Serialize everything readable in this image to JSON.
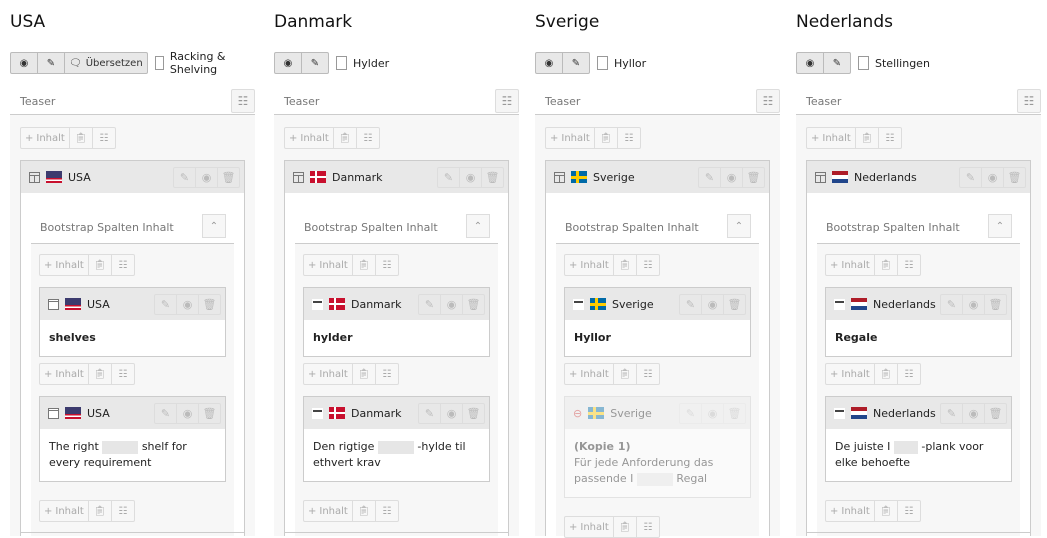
{
  "columns": [
    {
      "language": "USA",
      "flag": "flag-us",
      "toolbar": {
        "view_icon": "eye-icon",
        "edit_icon": "pencil-icon",
        "translate_label": "Übersetzen"
      },
      "page_title": "Racking & Shelving",
      "teaser_label": "Teaser",
      "container": {
        "label": "USA",
        "section_title": "Bootstrap Spalten Inhalt"
      },
      "elements": [
        {
          "label": "USA",
          "text": "shelves",
          "bold": true,
          "hidden": false
        },
        {
          "label": "USA",
          "text_before": "The right",
          "text_after": "shelf for every requirement",
          "bold": false,
          "hidden": false
        }
      ]
    },
    {
      "language": "Danmark",
      "flag": "flag-dk",
      "toolbar": {
        "view_icon": "eye-icon",
        "edit_icon": "pencil-icon"
      },
      "page_title": "Hylder",
      "teaser_label": "Teaser",
      "container": {
        "label": "Danmark",
        "section_title": "Bootstrap Spalten Inhalt"
      },
      "elements": [
        {
          "label": "Danmark",
          "text": "hylder",
          "bold": true,
          "hidden": false
        },
        {
          "label": "Danmark",
          "text_before": "Den rigtige",
          "text_after": "-hylde til ethvert krav",
          "bold": false,
          "hidden": false
        }
      ]
    },
    {
      "language": "Sverige",
      "flag": "flag-se",
      "toolbar": {
        "view_icon": "eye-icon",
        "edit_icon": "pencil-icon"
      },
      "page_title": "Hyllor",
      "teaser_label": "Teaser",
      "container": {
        "label": "Sverige",
        "section_title": "Bootstrap Spalten Inhalt"
      },
      "elements": [
        {
          "label": "Sverige",
          "text": "Hyllor",
          "bold": true,
          "hidden": false
        },
        {
          "label": "Sverige",
          "copy_label": "(Kopie 1)",
          "text_before": "Für jede Anforderung das passende I",
          "text_after": "Regal",
          "bold": false,
          "hidden": true
        }
      ]
    },
    {
      "language": "Nederlands",
      "flag": "flag-nl",
      "toolbar": {
        "view_icon": "eye-icon",
        "edit_icon": "pencil-icon"
      },
      "page_title": "Stellingen",
      "teaser_label": "Teaser",
      "container": {
        "label": "Nederlands",
        "section_title": "Bootstrap Spalten Inhalt"
      },
      "elements": [
        {
          "label": "Nederlands",
          "text": "Regale",
          "bold": true,
          "hidden": false
        },
        {
          "label": "Nederlands",
          "text_before": "De juiste I",
          "text_after": "-plank voor elke behoefte",
          "bold": false,
          "hidden": false
        }
      ]
    }
  ],
  "add_content_label": "Inhalt",
  "icons": {
    "add": "plus-icon",
    "paste": "clipboard-icon",
    "paste_reference": "paste-reference-icon",
    "edit": "pencil-icon",
    "toggle": "toggle-icon",
    "delete": "trash-icon",
    "collapse": "chevron-up-icon"
  }
}
